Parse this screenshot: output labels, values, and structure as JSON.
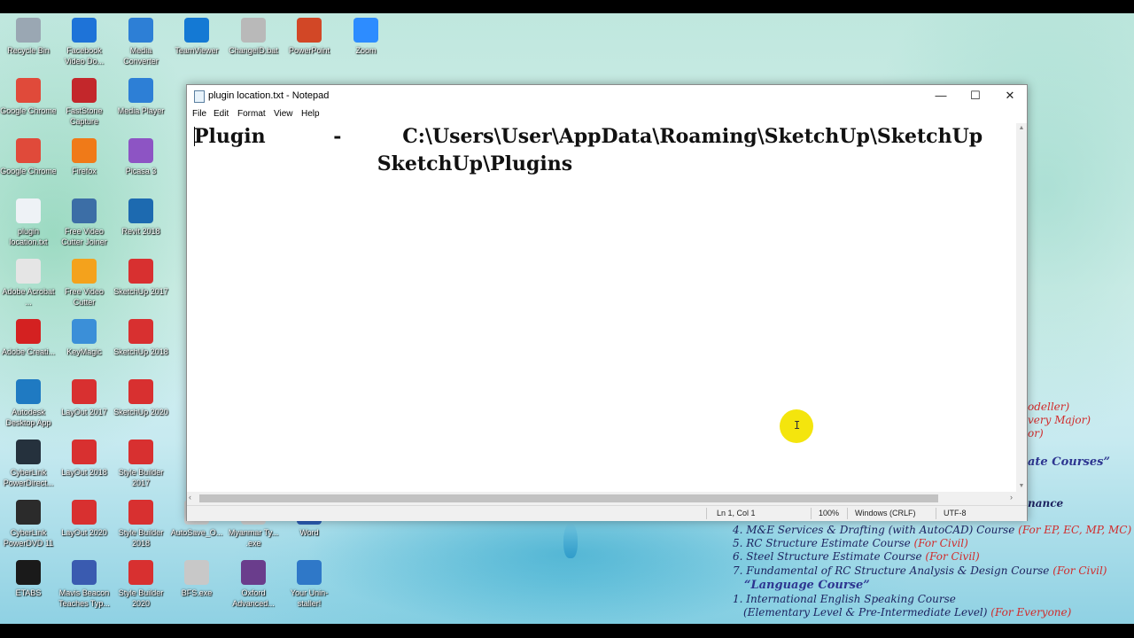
{
  "desktop": {
    "icons": [
      {
        "label": "Recycle Bin",
        "color": "#9aa7b3"
      },
      {
        "label": "Facebook Video Do...",
        "color": "#1e73d8"
      },
      {
        "label": "Media Converter",
        "color": "#2d7fd6"
      },
      {
        "label": "TeamViewer",
        "color": "#1479d4"
      },
      {
        "label": "ChangeID.bat",
        "color": "#b9b9b9"
      },
      {
        "label": "PowerPoint",
        "color": "#d24726"
      },
      {
        "label": "Zoom",
        "color": "#2d8cff"
      },
      {
        "label": "Google Chrome",
        "color": "#e04a3a"
      },
      {
        "label": "FastStone Capture",
        "color": "#c3272b"
      },
      {
        "label": "Media Player",
        "color": "#2d7fd6"
      },
      {
        "label": "Google Chrome",
        "color": "#e04a3a"
      },
      {
        "label": "Firefox",
        "color": "#f07a18"
      },
      {
        "label": "Picasa 3",
        "color": "#8d54c4"
      },
      {
        "label": "plugin location.txt",
        "color": "#eef2f6"
      },
      {
        "label": "Free Video Cutter Joiner",
        "color": "#3c6ea6"
      },
      {
        "label": "Revit 2018",
        "color": "#1d6ab0"
      },
      {
        "label": "Adobe Acrobat ...",
        "color": "#e5e5e5"
      },
      {
        "label": "Free Video Cutter",
        "color": "#f4a21c"
      },
      {
        "label": "SketchUp 2017",
        "color": "#d83030"
      },
      {
        "label": "Adobe Creati...",
        "color": "#d42121"
      },
      {
        "label": "KeyMagic",
        "color": "#3b8fd8"
      },
      {
        "label": "SketchUp 2018",
        "color": "#d83030"
      },
      {
        "label": "Autodesk Desktop App",
        "color": "#1f7ac2"
      },
      {
        "label": "LayOut 2017",
        "color": "#d83030"
      },
      {
        "label": "SketchUp 2020",
        "color": "#d83030"
      },
      {
        "label": "CyberLink PowerDirect...",
        "color": "#25313d"
      },
      {
        "label": "LayOut 2018",
        "color": "#d83030"
      },
      {
        "label": "Style Builder 2017",
        "color": "#d83030"
      },
      {
        "label": "CyberLink PowerDVD 11",
        "color": "#2b2b2b"
      },
      {
        "label": "LayOut 2020",
        "color": "#d83030"
      },
      {
        "label": "Style Builder 2018",
        "color": "#d83030"
      },
      {
        "label": "AutoSave_O...",
        "color": "#d0d0d0"
      },
      {
        "label": "Myanmar Ty... .exe",
        "color": "#d0d0d0"
      },
      {
        "label": "Word",
        "color": "#2b5cb5"
      },
      {
        "label": "ETABS",
        "color": "#1a1a1a"
      },
      {
        "label": "Mavis Beacon Teaches Typ...",
        "color": "#3a5bb0"
      },
      {
        "label": "Style Builder 2020",
        "color": "#d83030"
      },
      {
        "label": "BFS.exe",
        "color": "#c8c8c8"
      },
      {
        "label": "Oxford Advanced...",
        "color": "#6a3d8c"
      },
      {
        "label": "Your Unin-staller!",
        "color": "#2f78c8"
      }
    ]
  },
  "notepad": {
    "title": "plugin location.txt - Notepad",
    "controls": {
      "minimize": "—",
      "maximize": "☐",
      "close": "✕"
    },
    "menu": [
      "File",
      "Edit",
      "Format",
      "View",
      "Help"
    ],
    "content": {
      "line1": "Plugin          -         C:\\Users\\User\\AppData\\Roaming\\SketchUp\\SketchUp",
      "line2": "                           SketchUp\\Plugins"
    },
    "status": {
      "position": "Ln 1, Col 1",
      "zoom": "100%",
      "line_ending": "Windows (CRLF)",
      "encoding": "UTF-8"
    }
  },
  "background_text": {
    "frag1": "odeller)",
    "frag2": "very Major)",
    "frag3": "or)",
    "frag4": "ate Courses”",
    "frag5": "nance",
    "course4": "4. M&E Services & Drafting (with AutoCAD) Course",
    "course4_tag": "(For EP, EC, MP, MC)",
    "course5": "5. RC Structure Estimate Course",
    "course5_tag": "(For Civil)",
    "course6": "6. Steel Structure Estimate Course",
    "course6_tag": "(For Civil)",
    "course7": "7. Fundamental of RC Structure Analysis & Design Course",
    "course7_tag": "(For Civil)",
    "language_heading": "“Language Course”",
    "lang1": "1. International English Speaking Course",
    "lang1b": "(Elementary Level & Pre-Intermediate Level)",
    "lang1_tag": "(For Everyone)"
  },
  "colors": {
    "accent_red": "#d12b2b",
    "navy": "#1d2360",
    "cursor_highlight": "#f3e400"
  }
}
